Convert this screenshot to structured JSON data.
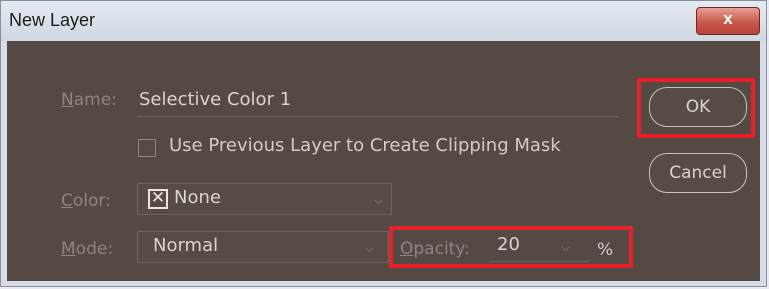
{
  "window": {
    "title": "New Layer",
    "close_glyph": "x"
  },
  "form": {
    "name": {
      "label_u": "N",
      "label_rest": "ame:",
      "value": "Selective Color 1"
    },
    "clipping": {
      "label": "Use Previous Layer to Create Clipping Mask",
      "checked": false
    },
    "color": {
      "label_u": "C",
      "label_rest": "olor:",
      "value": "None",
      "icon": "x-swatch-icon"
    },
    "mode": {
      "label_u": "M",
      "label_rest": "ode:",
      "value": "Normal"
    },
    "opacity": {
      "label_u": "O",
      "label_rest": "pacity:",
      "value": "20",
      "unit": "%"
    }
  },
  "buttons": {
    "ok": "OK",
    "cancel": "Cancel"
  },
  "highlight_color": "#e8202a"
}
